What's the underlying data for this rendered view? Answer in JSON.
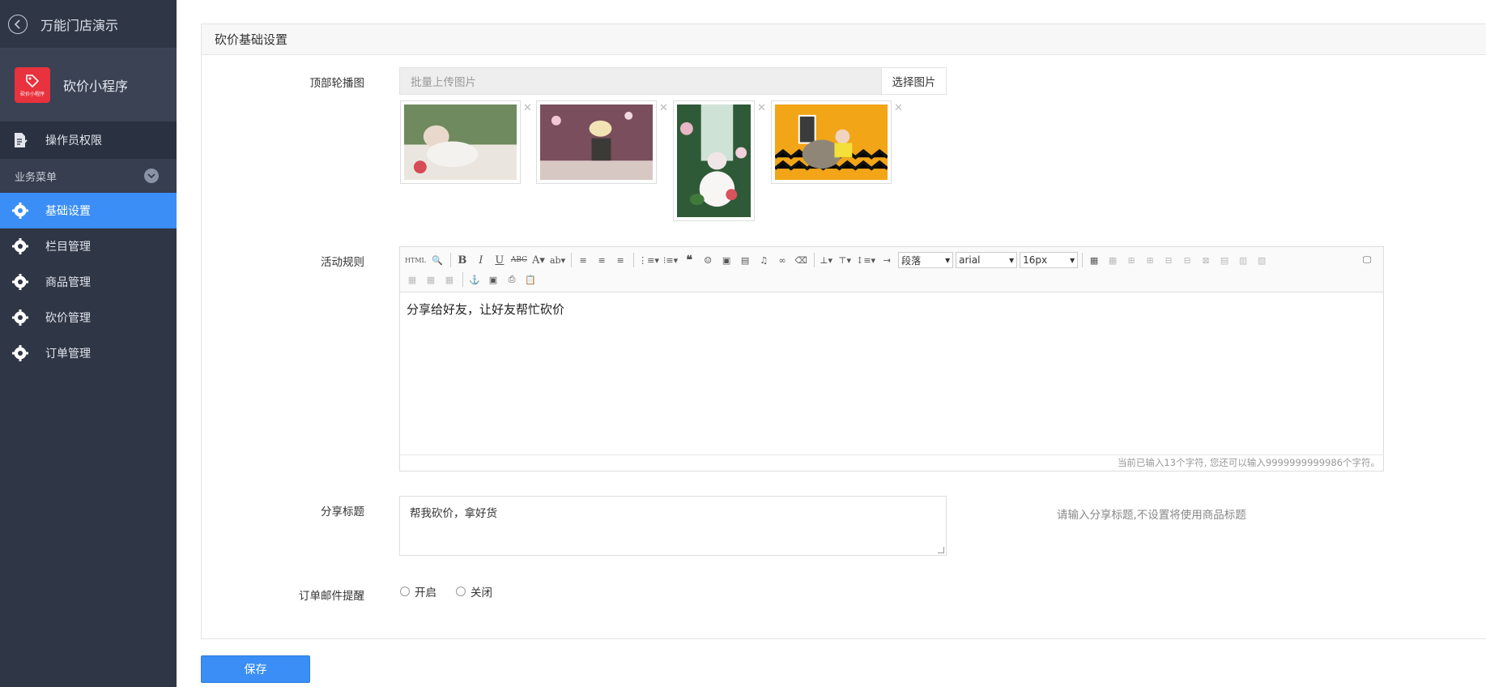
{
  "sidebar": {
    "title": "万能门店演示",
    "app_name": "砍价小程序",
    "logo_text": "砍价小程序",
    "perm_label": "操作员权限",
    "group_label": "业务菜单",
    "items": [
      {
        "label": "基础设置",
        "active": true
      },
      {
        "label": "栏目管理"
      },
      {
        "label": "商品管理"
      },
      {
        "label": "砍价管理"
      },
      {
        "label": "订单管理"
      }
    ]
  },
  "panel": {
    "title": "砍价基础设置"
  },
  "carousel": {
    "label": "顶部轮播图",
    "placeholder": "批量上传图片",
    "select_button": "选择图片"
  },
  "rules": {
    "label": "活动规则",
    "content": "分享给好友，让好友帮忙砍价",
    "toolbar": {
      "html": "HTML",
      "paragraph": "段落",
      "font": "arial",
      "size": "16px"
    },
    "counter": "当前已输入13个字符, 您还可以输入9999999999986个字符。"
  },
  "share": {
    "label": "分享标题",
    "value": "帮我砍价，拿好货",
    "hint": "请输入分享标题,不设置将使用商品标题"
  },
  "email": {
    "label": "订单邮件提醒",
    "on": "开启",
    "off": "关闭"
  },
  "save_label": "保存",
  "colors": {
    "sidebar_bg": "#2f3646",
    "accent": "#3a8ef6",
    "logo_red": "#e8323d"
  }
}
